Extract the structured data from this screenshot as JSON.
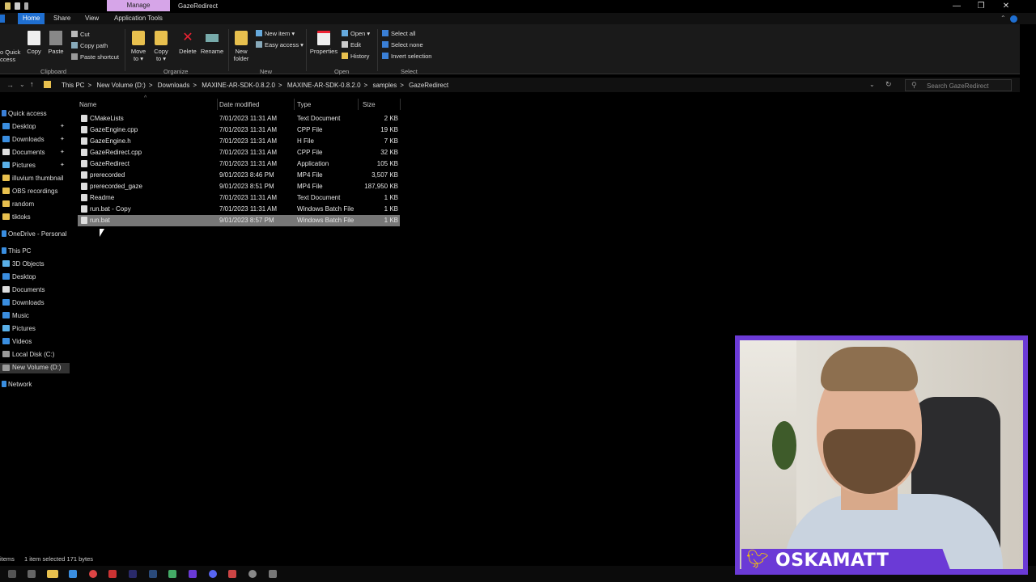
{
  "titlebar": {
    "context_tab": "Manage",
    "window_title": "GazeRedirect",
    "minimize": "—",
    "maximize": "❐",
    "close": "✕"
  },
  "tabs": {
    "home": "Home",
    "share": "Share",
    "view": "View",
    "application_tools": "Application Tools"
  },
  "ribbon": {
    "pin_to_quick": "o Quick",
    "pin_to_quick2": "ccess",
    "copy": "Copy",
    "paste": "Paste",
    "cut": "Cut",
    "copy_path": "Copy path",
    "paste_shortcut": "Paste shortcut",
    "move_to": "Move",
    "move_to2": "to ▾",
    "copy_to": "Copy",
    "copy_to2": "to ▾",
    "delete": "Delete",
    "rename": "Rename",
    "new_folder": "New",
    "new_folder2": "folder",
    "new_item": "New item ▾",
    "easy_access": "Easy access ▾",
    "properties": "Properties",
    "open": "Open ▾",
    "edit": "Edit",
    "history": "History",
    "select_all": "Select all",
    "select_none": "Select none",
    "invert_selection": "Invert selection",
    "groups": {
      "clipboard": "Clipboard",
      "organize": "Organize",
      "new": "New",
      "open": "Open",
      "select": "Select"
    }
  },
  "address": {
    "crumbs": [
      "This PC",
      ">",
      "New Volume (D:)",
      ">",
      "Downloads",
      ">",
      "MAXINE-AR-SDK-0.8.2.0",
      ">",
      "MAXINE-AR-SDK-0.8.2.0",
      ">",
      "samples",
      ">",
      "GazeRedirect"
    ],
    "search_placeholder": "Search GazeRedirect"
  },
  "nav": {
    "quick_access": "Quick access",
    "items": [
      "Desktop",
      "Downloads",
      "Documents",
      "Pictures",
      "illuvium thumbnail",
      "OBS recordings",
      "random",
      "tiktoks"
    ],
    "onedrive": "OneDrive - Personal",
    "this_pc": "This PC",
    "pc_items": [
      "3D Objects",
      "Desktop",
      "Documents",
      "Downloads",
      "Music",
      "Pictures",
      "Videos",
      "Local Disk (C:)",
      "New Volume (D:)"
    ],
    "network": "Network"
  },
  "columns": {
    "name": "Name",
    "date": "Date modified",
    "type": "Type",
    "size": "Size"
  },
  "files": [
    {
      "name": "CMakeLists",
      "date": "7/01/2023 11:31 AM",
      "type": "Text Document",
      "size": "2 KB"
    },
    {
      "name": "GazeEngine.cpp",
      "date": "7/01/2023 11:31 AM",
      "type": "CPP File",
      "size": "19 KB"
    },
    {
      "name": "GazeEngine.h",
      "date": "7/01/2023 11:31 AM",
      "type": "H File",
      "size": "7 KB"
    },
    {
      "name": "GazeRedirect.cpp",
      "date": "7/01/2023 11:31 AM",
      "type": "CPP File",
      "size": "32 KB"
    },
    {
      "name": "GazeRedirect",
      "date": "7/01/2023 11:31 AM",
      "type": "Application",
      "size": "105 KB"
    },
    {
      "name": "prerecorded",
      "date": "9/01/2023 8:46 PM",
      "type": "MP4 File",
      "size": "3,507 KB"
    },
    {
      "name": "prerecorded_gaze",
      "date": "9/01/2023 8:51 PM",
      "type": "MP4 File",
      "size": "187,950 KB"
    },
    {
      "name": "Readme",
      "date": "7/01/2023 11:31 AM",
      "type": "Text Document",
      "size": "1 KB"
    },
    {
      "name": "run.bat - Copy",
      "date": "7/01/2023 11:31 AM",
      "type": "Windows Batch File",
      "size": "1 KB"
    },
    {
      "name": "run.bat",
      "date": "9/01/2023 8:57 PM",
      "type": "Windows Batch File",
      "size": "1 KB"
    }
  ],
  "status": {
    "items": "items",
    "selected": "1 item selected  171 bytes"
  },
  "webcam": {
    "handle": "OSKAMATT",
    "bird_icon": "twitter-bird-icon"
  },
  "colors": {
    "accent": "#1f6fd1",
    "selected_row": "#777777",
    "manage_tab": "#d6a5e8",
    "cam_border": "#6b3ad6",
    "twitter_yellow": "#f2c20a"
  }
}
